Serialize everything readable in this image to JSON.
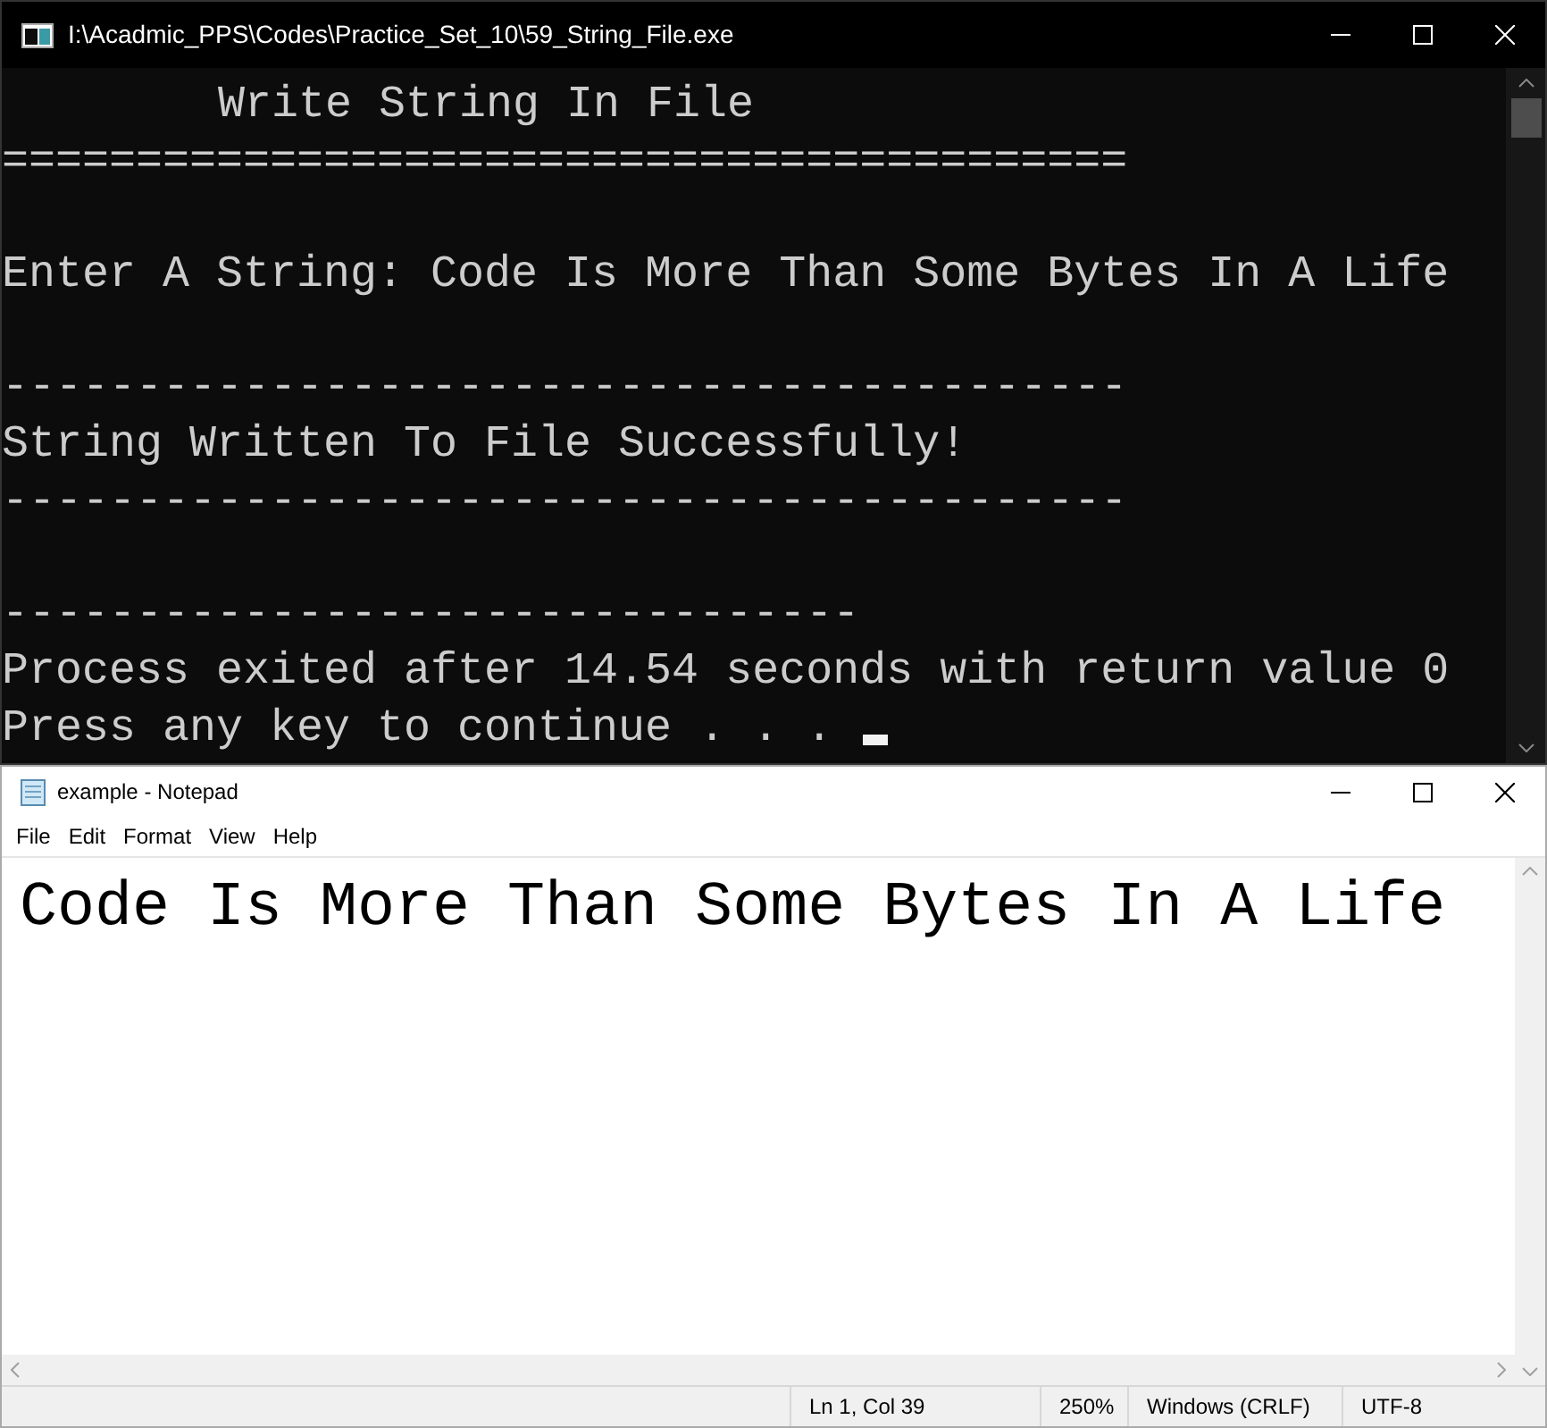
{
  "console": {
    "title": "I:\\Acadmic_PPS\\Codes\\Practice_Set_10\\59_String_File.exe",
    "lines": [
      {
        "kind": "heading",
        "text": "Write String In File"
      },
      {
        "kind": "text",
        "text": "=========================================="
      },
      {
        "kind": "blank"
      },
      {
        "kind": "text",
        "text": "Enter A String: Code Is More Than Some Bytes In A Life"
      },
      {
        "kind": "blank"
      },
      {
        "kind": "text",
        "text": "------------------------------------------"
      },
      {
        "kind": "text",
        "text": "String Written To File Successfully!"
      },
      {
        "kind": "text",
        "text": "------------------------------------------"
      },
      {
        "kind": "blank"
      },
      {
        "kind": "text",
        "text": "--------------------------------"
      },
      {
        "kind": "text",
        "text": "Process exited after 14.54 seconds with return value 0"
      },
      {
        "kind": "prompt",
        "text": "Press any key to continue . . ."
      }
    ]
  },
  "notepad": {
    "title": "example - Notepad",
    "menu": [
      "File",
      "Edit",
      "Format",
      "View",
      "Help"
    ],
    "content": "Code Is More Than Some Bytes In A Life",
    "status_bar": [
      "Ln 1, Col 39",
      "250%",
      "Windows (CRLF)",
      "UTF-8"
    ]
  }
}
